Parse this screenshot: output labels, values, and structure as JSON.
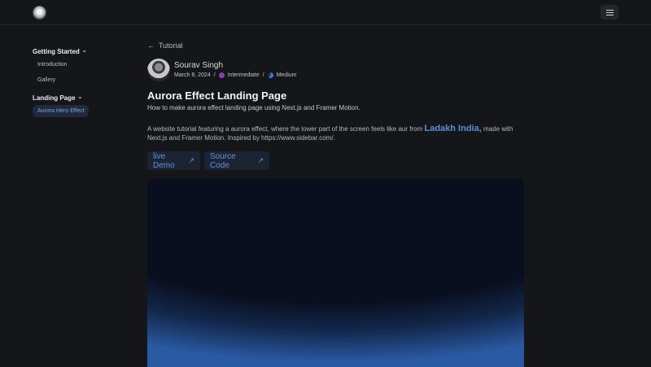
{
  "header": {
    "logo_icon": "logo-icon",
    "menu_icon": "hamburger-menu-icon"
  },
  "sidebar": {
    "sections": [
      {
        "heading": "Getting Started",
        "items": [
          "Introduction",
          "Gallery"
        ]
      },
      {
        "heading": "Landing Page",
        "items": [
          "Aurora Hero Effect"
        ]
      }
    ]
  },
  "main": {
    "back_label": "Tutorial",
    "author": "Sourav Singh",
    "date": "March 8, 2024",
    "separator": "/",
    "level": "Intermediate",
    "difficulty": "Medium",
    "title": "Aurora Effect Landing Page",
    "subtitle": "How to make aurora effect landing page using Next.js and Framer Motion.",
    "description_before": "A website tutorial featuring a aurora effect, where the lower part of the screen feels like aur from ",
    "description_place": "Ladakh India,",
    "description_after": " made with Next.js and Framer Motion. Inspired by https://www.sidebar.com/.",
    "demo_label": "live Demo",
    "source_label": "Source Code"
  },
  "colors": {
    "background": "#141619",
    "accent": "#5f93e0",
    "intermediate": "#8a3fb8"
  }
}
